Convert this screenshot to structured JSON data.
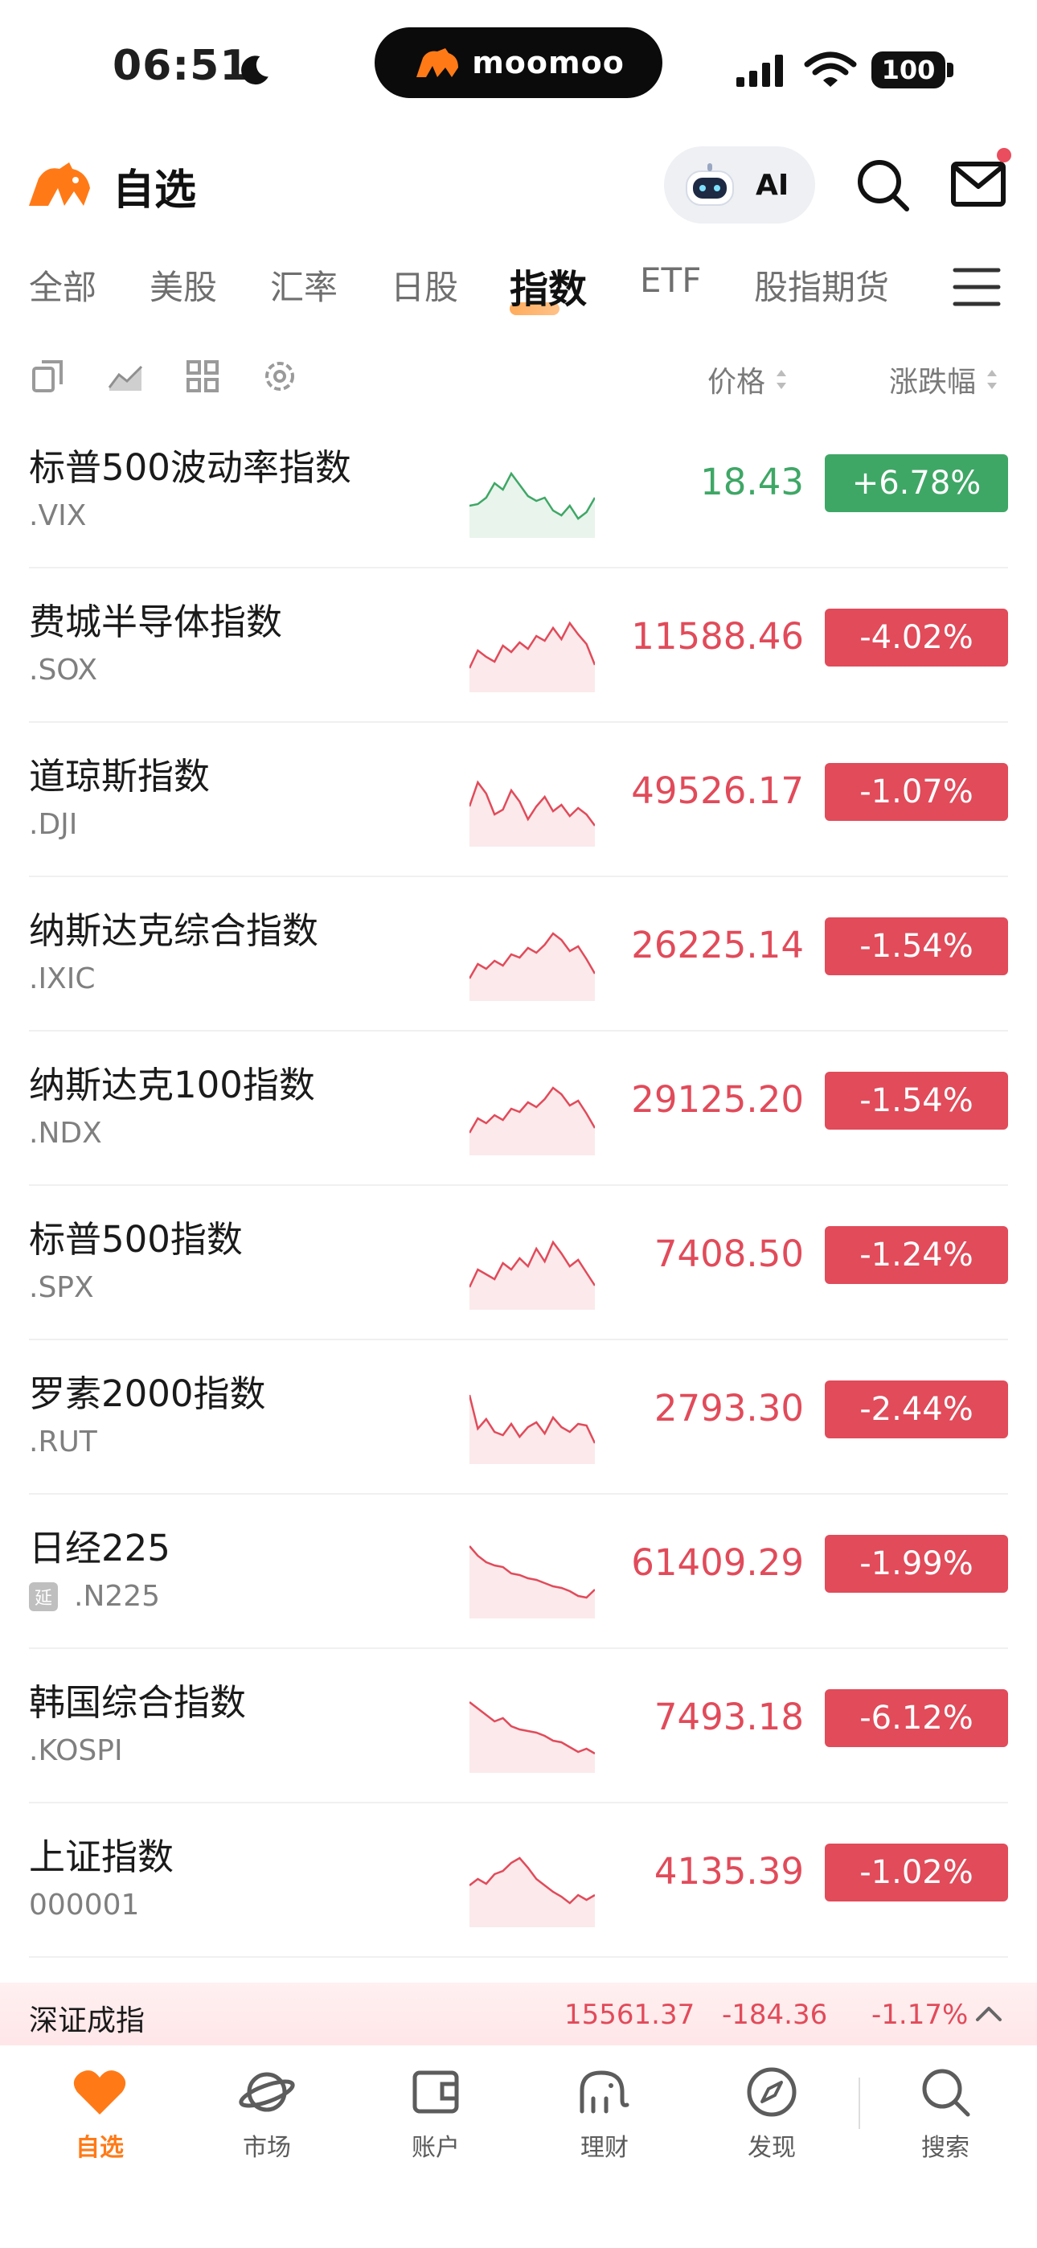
{
  "status": {
    "time": "06:51",
    "island_brand": "moomoo",
    "battery": "100"
  },
  "header": {
    "title": "自选",
    "ai_label": "AI"
  },
  "tabs": [
    {
      "label": "全部",
      "active": false
    },
    {
      "label": "美股",
      "active": false
    },
    {
      "label": "汇率",
      "active": false
    },
    {
      "label": "日股",
      "active": false
    },
    {
      "label": "指数",
      "active": true
    },
    {
      "label": "ETF",
      "active": false
    },
    {
      "label": "股指期货",
      "active": false
    }
  ],
  "columns": {
    "price": "价格",
    "change": "涨跌幅"
  },
  "colors": {
    "up": "#3fa766",
    "down": "#e14b5a",
    "accent": "#ff7a17"
  },
  "rows": [
    {
      "name": "标普500波动率指数",
      "code": ".VIX",
      "price": "18.43",
      "change": "+6.78%",
      "direction": "up",
      "delayed": false
    },
    {
      "name": "费城半导体指数",
      "code": ".SOX",
      "price": "11588.46",
      "change": "-4.02%",
      "direction": "down",
      "delayed": false
    },
    {
      "name": "道琼斯指数",
      "code": ".DJI",
      "price": "49526.17",
      "change": "-1.07%",
      "direction": "down",
      "delayed": false
    },
    {
      "name": "纳斯达克综合指数",
      "code": ".IXIC",
      "price": "26225.14",
      "change": "-1.54%",
      "direction": "down",
      "delayed": false
    },
    {
      "name": "纳斯达克100指数",
      "code": ".NDX",
      "price": "29125.20",
      "change": "-1.54%",
      "direction": "down",
      "delayed": false
    },
    {
      "name": "标普500指数",
      "code": ".SPX",
      "price": "7408.50",
      "change": "-1.24%",
      "direction": "down",
      "delayed": false
    },
    {
      "name": "罗素2000指数",
      "code": ".RUT",
      "price": "2793.30",
      "change": "-2.44%",
      "direction": "down",
      "delayed": false
    },
    {
      "name": "日经225",
      "code": ".N225",
      "price": "61409.29",
      "change": "-1.99%",
      "direction": "down",
      "delayed": true,
      "delay_label": "延"
    },
    {
      "name": "韩国综合指数",
      "code": ".KOSPI",
      "price": "7493.18",
      "change": "-6.12%",
      "direction": "down",
      "delayed": false
    },
    {
      "name": "上证指数",
      "code": "000001",
      "price": "4135.39",
      "change": "-1.02%",
      "direction": "down",
      "delayed": false
    }
  ],
  "ticker": {
    "name": "深证成指",
    "price": "15561.37",
    "change": "-184.36",
    "change_pct": "-1.17%"
  },
  "nav": [
    {
      "label": "自选",
      "icon": "heart-icon",
      "active": true
    },
    {
      "label": "市场",
      "icon": "planet-icon",
      "active": false
    },
    {
      "label": "账户",
      "icon": "wallet-icon",
      "active": false
    },
    {
      "label": "理财",
      "icon": "elephant-icon",
      "active": false
    },
    {
      "label": "发现",
      "icon": "compass-icon",
      "active": false
    },
    {
      "label": "搜索",
      "icon": "search-icon",
      "active": false
    }
  ]
}
